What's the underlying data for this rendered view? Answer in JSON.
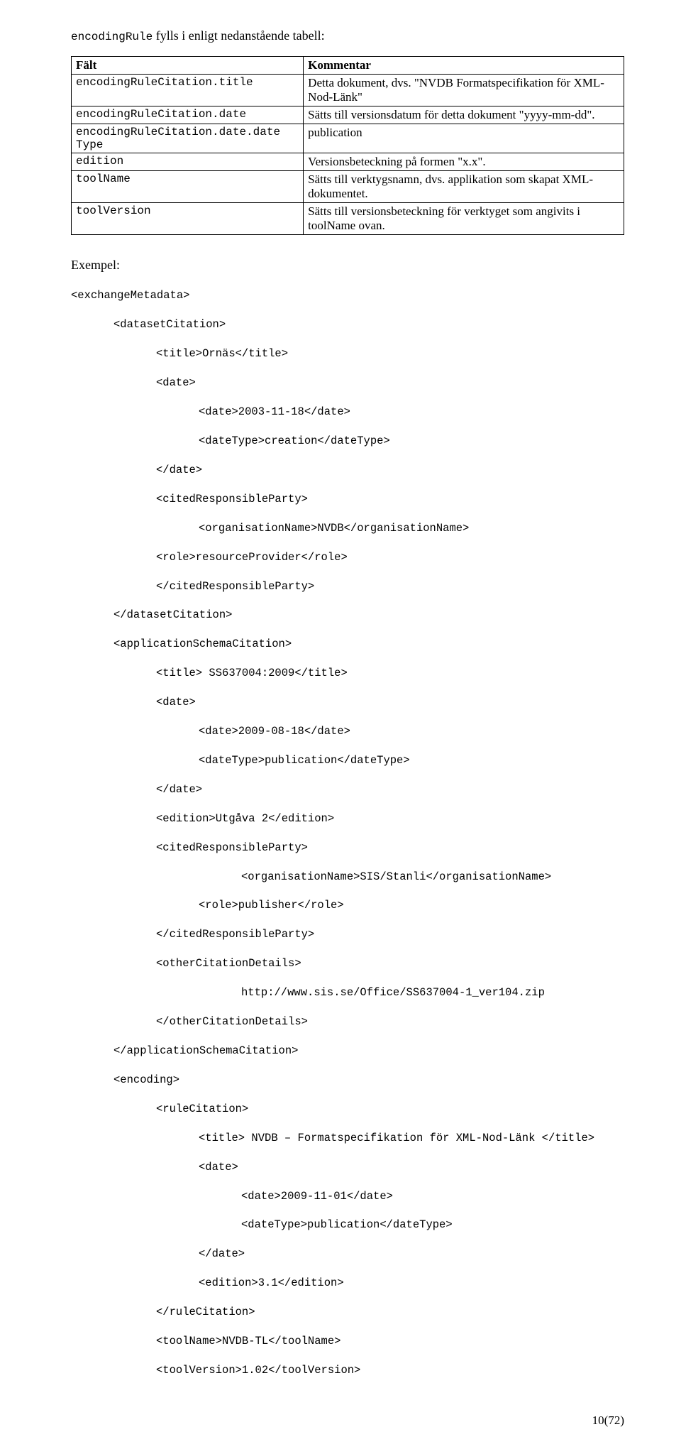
{
  "intro": {
    "mono": "encodingRule",
    "rest": " fylls i enligt nedanstående tabell:"
  },
  "table": {
    "headers": [
      "Fält",
      "Kommentar"
    ],
    "rows": [
      {
        "field": "encodingRuleCitation.title",
        "comment": "Detta dokument, dvs. \"NVDB Formatspecifikation för XML-Nod-Länk\""
      },
      {
        "field": "encodingRuleCitation.date",
        "comment": "Sätts till versionsdatum för detta dokument \"yyyy-mm-dd\"."
      },
      {
        "field": "encodingRuleCitation.date.date\nType",
        "comment": "publication"
      },
      {
        "field": "edition",
        "comment": "Versionsbeteckning på formen \"x.x\"."
      },
      {
        "field": "toolName",
        "comment": "Sätts till verktygsnamn, dvs. applikation som skapat XML-dokumentet."
      },
      {
        "field": "toolVersion",
        "comment": "Sätts till versionsbeteckning för verktyget som angivits i toolName ovan."
      }
    ]
  },
  "example_label": "Exempel:",
  "code": {
    "l01": "<exchangeMetadata>",
    "l02": "<datasetCitation>",
    "l03": "<title>Ornäs</title>",
    "l04": "<date>",
    "l05": "<date>2003-11-18</date>",
    "l06": "<dateType>creation</dateType>",
    "l07": "</date>",
    "l08": "<citedResponsibleParty>",
    "l09": "<organisationName>NVDB</organisationName>",
    "l10": "<role>resourceProvider</role>",
    "l11": "</citedResponsibleParty>",
    "l12": "</datasetCitation>",
    "l13": "<applicationSchemaCitation>",
    "l14": "<title> SS637004:2009</title>",
    "l15": "<date>",
    "l16": "<date>2009-08-18</date>",
    "l17": "<dateType>publication</dateType>",
    "l18": "</date>",
    "l19": "<edition>Utgåva 2</edition>",
    "l20": "<citedResponsibleParty>",
    "l21": "<organisationName>SIS/Stanli</organisationName>",
    "l22": "<role>publisher</role>",
    "l23": "</citedResponsibleParty>",
    "l24": "<otherCitationDetails>",
    "l25": "http://www.sis.se/Office/SS637004-1_ver104.zip",
    "l26": "</otherCitationDetails>",
    "l27": "</applicationSchemaCitation>",
    "l28": "<encoding>",
    "l29": "<ruleCitation>",
    "l30": "<title> NVDB – Formatspecifikation för XML-Nod-Länk </title>",
    "l31": "<date>",
    "l32": "<date>2009-11-01</date>",
    "l33": "<dateType>publication</dateType>",
    "l34": "</date>",
    "l35": "<edition>3.1</edition>",
    "l36": "</ruleCitation>",
    "l37": "<toolName>NVDB-TL</toolName>",
    "l38": "<toolVersion>1.02</toolVersion>"
  },
  "page_number": "10(72)"
}
